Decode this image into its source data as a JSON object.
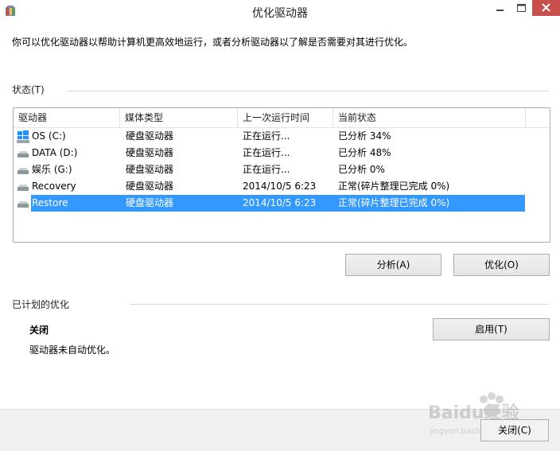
{
  "window": {
    "title": "优化驱动器"
  },
  "description": "你可以优化驱动器以帮助计算机更高效地运行，或者分析驱动器以了解是否需要对其进行优化。",
  "status_group": {
    "label": "状态(T)"
  },
  "columns": [
    "驱动器",
    "媒体类型",
    "上一次运行时间",
    "当前状态"
  ],
  "drives": [
    {
      "name": "OS (C:)",
      "media": "硬盘驱动器",
      "last_run": "正在运行...",
      "status": "已分析 34%",
      "icon": "windows-drive-icon"
    },
    {
      "name": "DATA (D:)",
      "media": "硬盘驱动器",
      "last_run": "正在运行...",
      "status": "已分析 48%",
      "icon": "hard-drive-icon"
    },
    {
      "name": "娱乐 (G:)",
      "media": "硬盘驱动器",
      "last_run": "正在运行...",
      "status": "已分析 0%",
      "icon": "hard-drive-icon"
    },
    {
      "name": "Recovery",
      "media": "硬盘驱动器",
      "last_run": "2014/10/5 6:23",
      "status": "正常(碎片整理已完成 0%)",
      "icon": "hard-drive-icon"
    },
    {
      "name": "Restore",
      "media": "硬盘驱动器",
      "last_run": "2014/10/5 6:23",
      "status": "正常(碎片整理已完成 0%)",
      "icon": "hard-drive-icon",
      "selected": true
    }
  ],
  "buttons": {
    "analyze": "分析(A)",
    "optimize": "优化(O)",
    "enable": "启用(T)",
    "close": "关闭(C)"
  },
  "scheduled": {
    "label": "已计划的优化",
    "state": "关闭",
    "detail": "驱动器未自动优化。"
  },
  "watermark": {
    "text": "Baidu经验",
    "sub": "jingyan.baidu.com"
  },
  "colors": {
    "selection": "#3399ff",
    "close_button": "#c7504c",
    "band": "#f0f0f0"
  }
}
